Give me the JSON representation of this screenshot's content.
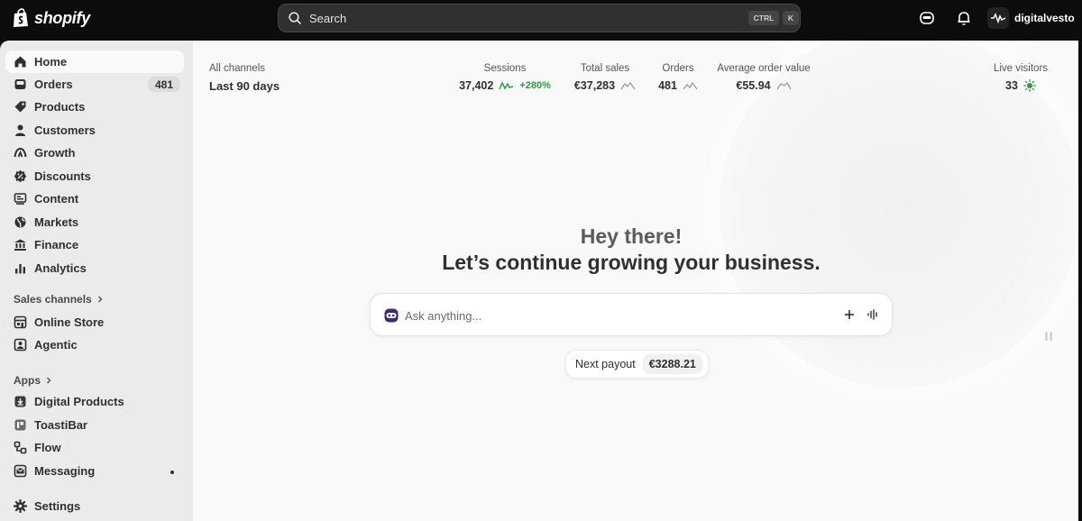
{
  "brand": {
    "name": "shopify"
  },
  "search": {
    "placeholder": "Search",
    "shortcut_1": "CTRL",
    "shortcut_2": "K"
  },
  "store": {
    "name": "digitalvesto"
  },
  "sidebar": {
    "items": [
      {
        "label": "Home",
        "icon": "home-icon",
        "active": true
      },
      {
        "label": "Orders",
        "icon": "inbox-icon",
        "badge": "481"
      },
      {
        "label": "Products",
        "icon": "tag-icon"
      },
      {
        "label": "Customers",
        "icon": "person-icon"
      },
      {
        "label": "Growth",
        "icon": "growth-icon"
      },
      {
        "label": "Discounts",
        "icon": "discount-icon"
      },
      {
        "label": "Content",
        "icon": "content-icon"
      },
      {
        "label": "Markets",
        "icon": "globe-icon"
      },
      {
        "label": "Finance",
        "icon": "bank-icon"
      },
      {
        "label": "Analytics",
        "icon": "bar-chart-icon"
      }
    ],
    "sales_channels": {
      "heading": "Sales channels",
      "items": [
        {
          "label": "Online Store",
          "icon": "storefront-icon"
        },
        {
          "label": "Agentic",
          "icon": "agentic-icon"
        }
      ]
    },
    "apps": {
      "heading": "Apps",
      "items": [
        {
          "label": "Digital Products",
          "icon": "download-box-icon"
        },
        {
          "label": "ToastiBar",
          "icon": "toastibar-icon"
        },
        {
          "label": "Flow",
          "icon": "flow-icon"
        },
        {
          "label": "Messaging",
          "icon": "mail-icon",
          "dot": true
        }
      ]
    },
    "settings": {
      "label": "Settings",
      "icon": "gear-icon"
    }
  },
  "metrics": {
    "channel_label": "All channels",
    "period": "Last 90 days",
    "sessions": {
      "label": "Sessions",
      "value": "37,402",
      "delta": "+280%"
    },
    "total_sales": {
      "label": "Total sales",
      "value": "€37,283"
    },
    "orders": {
      "label": "Orders",
      "value": "481"
    },
    "aov": {
      "label": "Average order value",
      "value": "€55.94"
    },
    "live": {
      "label": "Live visitors",
      "value": "33"
    }
  },
  "hero": {
    "greeting": "Hey there!",
    "subtitle": "Let’s continue growing your business."
  },
  "ask": {
    "placeholder": "Ask anything..."
  },
  "payout": {
    "label": "Next payout",
    "value": "€3288.21"
  },
  "colors": {
    "topbar": "#0c0c0c",
    "sidebar": "#ebebeb",
    "main": "#f9f9f9",
    "positive": "#2e9a46"
  }
}
